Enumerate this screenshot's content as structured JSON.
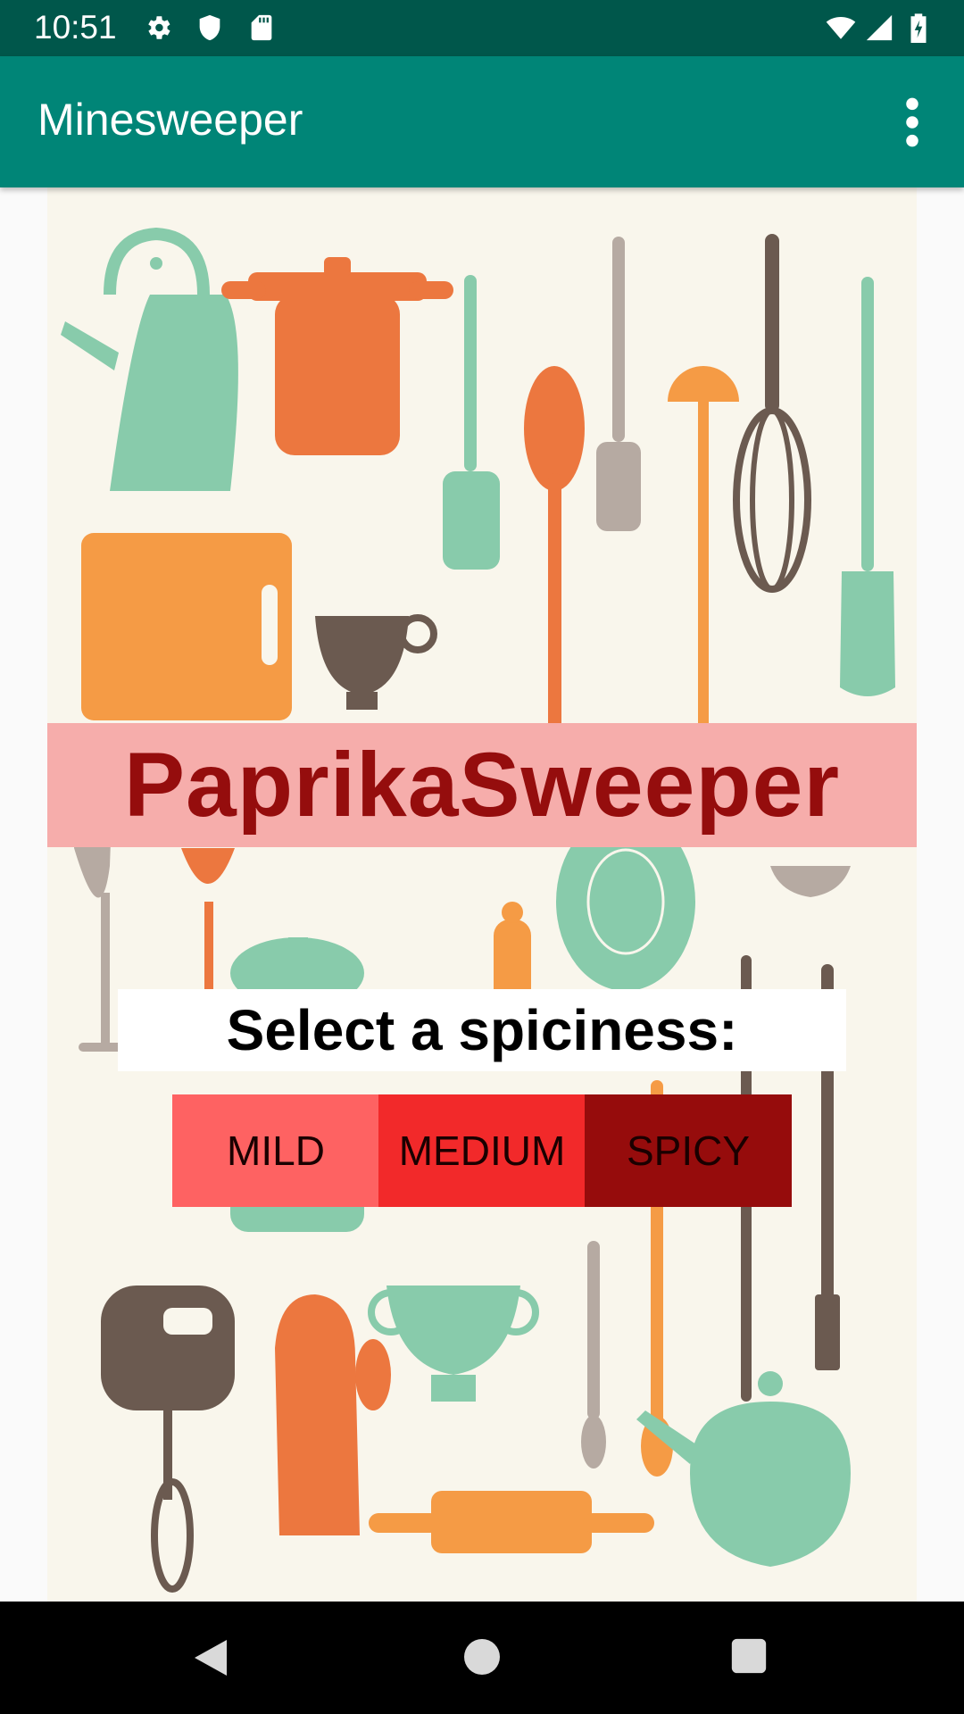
{
  "status_bar": {
    "time": "10:51",
    "icons": [
      "settings-icon",
      "shield-icon",
      "sd-card-icon",
      "wifi-icon",
      "signal-icon",
      "battery-charging-icon"
    ]
  },
  "app_bar": {
    "title": "Minesweeper",
    "overflow_icon": "more-vert-icon"
  },
  "main": {
    "game_title": "PaprikaSweeper",
    "prompt": "Select a spiciness:",
    "buttons": [
      {
        "label": "MILD",
        "color": "#fe6262"
      },
      {
        "label": "MEDIUM",
        "color": "#f2292a"
      },
      {
        "label": "SPICY",
        "color": "#960c0c"
      }
    ]
  },
  "nav_bar": {
    "icons": [
      "back-icon",
      "home-icon",
      "recents-icon"
    ]
  },
  "colors": {
    "status_bar": "#00574b",
    "app_bar": "#008577",
    "title_band": "#f6adab",
    "title_text": "#950d0d"
  }
}
